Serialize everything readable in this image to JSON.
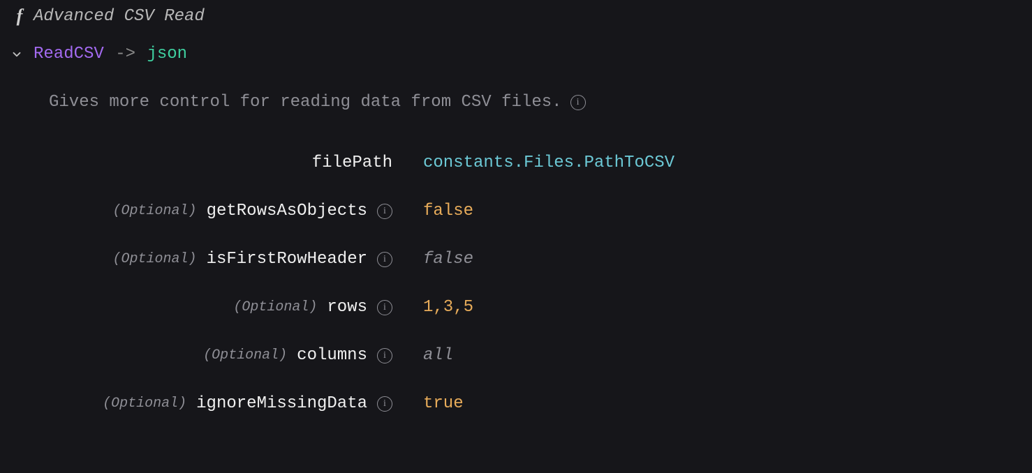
{
  "header": {
    "functionTitle": "Advanced CSV Read"
  },
  "signature": {
    "name": "ReadCSV",
    "arrow": "->",
    "returnType": "json"
  },
  "description": "Gives more control for reading data from CSV files.",
  "optionalTag": "(Optional)",
  "params": [
    {
      "name": "filePath",
      "optional": false,
      "value": "constants.Files.PathToCSV",
      "valueKind": "ref",
      "hasInfo": false
    },
    {
      "name": "getRowsAsObjects",
      "optional": true,
      "value": "false",
      "valueKind": "bool",
      "hasInfo": true
    },
    {
      "name": "isFirstRowHeader",
      "optional": true,
      "value": "false",
      "valueKind": "placeholder",
      "hasInfo": true
    },
    {
      "name": "rows",
      "optional": true,
      "value": "1,3,5",
      "valueKind": "num",
      "hasInfo": true
    },
    {
      "name": "columns",
      "optional": true,
      "value": "all",
      "valueKind": "placeholder",
      "hasInfo": true
    },
    {
      "name": "ignoreMissingData",
      "optional": true,
      "value": "true",
      "valueKind": "bool",
      "hasInfo": true
    }
  ]
}
